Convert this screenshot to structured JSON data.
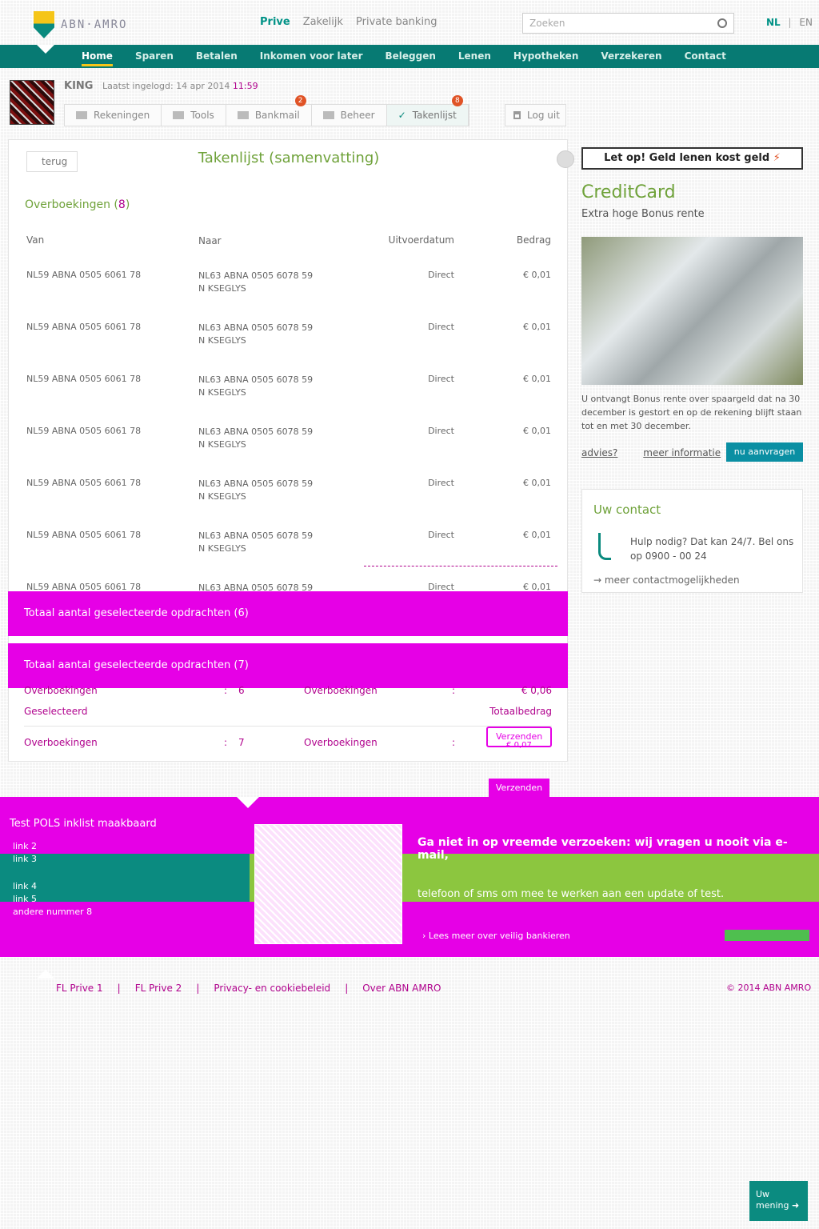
{
  "header": {
    "logo_text": "ABN·AMRO",
    "nav": [
      "Prive",
      "Zakelijk",
      "Private banking"
    ],
    "search_placeholder": "Zoeken",
    "lang_nl": "NL",
    "lang_sep": "|",
    "lang_en": "EN"
  },
  "mainnav": [
    "Home",
    "Sparen",
    "Betalen",
    "Inkomen voor later",
    "Beleggen",
    "Lenen",
    "Hypotheken",
    "Verzekeren",
    "Contact"
  ],
  "user": {
    "name": "KING",
    "last_login_label": "Laatst ingelogd: 14 apr 2014",
    "last_login_time": "11:59"
  },
  "tools": [
    {
      "label": "Rekeningen",
      "badge": ""
    },
    {
      "label": "Tools",
      "badge": ""
    },
    {
      "label": "Bankmail",
      "badge": "2"
    },
    {
      "label": "Beheer",
      "badge": ""
    },
    {
      "label": "Takenlijst",
      "badge": "8"
    }
  ],
  "logout": "Log uit",
  "panel": {
    "back": "terug",
    "title": "Takenlijst (samenvatting)",
    "section": "Overboekingen (",
    "section_count": "8",
    "section_close": ")",
    "columns": [
      "Van",
      "Naar",
      "Uitvoerdatum",
      "Bedrag"
    ],
    "rows": [
      {
        "from": "NL59 ABNA 0505 6061 78",
        "to": "NL63 ABNA 0505 6078 59",
        "to_name": "N KSEGLYS",
        "date": "Direct",
        "amount": "€ 0,01"
      },
      {
        "from": "NL59 ABNA 0505 6061 78",
        "to": "NL63 ABNA 0505 6078 59",
        "to_name": "N KSEGLYS",
        "date": "Direct",
        "amount": "€ 0,01"
      },
      {
        "from": "NL59 ABNA 0505 6061 78",
        "to": "NL63 ABNA 0505 6078 59",
        "to_name": "N KSEGLYS",
        "date": "Direct",
        "amount": "€ 0,01"
      },
      {
        "from": "NL59 ABNA 0505 6061 78",
        "to": "NL63 ABNA 0505 6078 59",
        "to_name": "N KSEGLYS",
        "date": "Direct",
        "amount": "€ 0,01"
      },
      {
        "from": "NL59 ABNA 0505 6061 78",
        "to": "NL63 ABNA 0505 6078 59",
        "to_name": "N KSEGLYS",
        "date": "Direct",
        "amount": "€ 0,01"
      },
      {
        "from": "NL59 ABNA 0505 6061 78",
        "to": "NL63 ABNA 0505 6078 59",
        "to_name": "N KSEGLYS",
        "date": "Direct",
        "amount": "€ 0,01"
      },
      {
        "from": "NL59 ABNA 0505 6061 78",
        "to": "NL63 ABNA 0505 6078 59",
        "to_name": "",
        "date": "Direct",
        "amount": "€ 0,01"
      }
    ],
    "total_bar_1": "Totaal aantal geselecteerde opdrachten (6)",
    "total_bar_2": "Totaal aantal geselecteerde opdrachten (7)",
    "summary1": {
      "label": "Overboekingen",
      "sep": ":",
      "count": "6",
      "label2": "Overboekingen",
      "sep2": ":",
      "amount": "€ 0,06"
    },
    "selected_label": "Geselecteerd",
    "total_amount_label": "Totaalbedrag",
    "summary2": {
      "label": "Overboekingen",
      "sep": ":",
      "count": "7",
      "label2": "Overboekingen",
      "sep2": ":",
      "amount": "€ 0,07"
    },
    "verzenden": "Verzenden",
    "send_all": "Verzenden"
  },
  "right": {
    "alert": "Let op! Geld lenen kost geld",
    "cc_title": "CreditCard",
    "cc_sub": "Extra hoge Bonus rente",
    "cc_text": "U ontvangt Bonus rente over spaargeld dat na 30 december is gestort en op de rekening blijft staan tot en met 30 december.",
    "links": [
      "advies?",
      "meer informatie"
    ],
    "cta": "nu aanvragen",
    "contact_title": "Uw contact",
    "contact_text": "Hulp nodig? Dat kan 24/7. Bel ons op 0900 - 00 24",
    "contact_more": "meer contactmogelijkheden"
  },
  "band": {
    "title": "Test POLS inklist maakbaard",
    "links": [
      "link 2",
      "link 3",
      "link 4",
      "link 5",
      "andere nummer 8"
    ],
    "headline": "Ga niet in op vreemde verzoeken: wij vragen u nooit via e-mail,",
    "body": "telefoon of sms om mee te werken aan een update of test.",
    "link": "Lees meer over veilig bankieren"
  },
  "footer": {
    "links": [
      "FL Prive 1",
      "FL Prive 2",
      "Privacy- en cookiebeleid",
      "Over ABN AMRO"
    ],
    "copyright": "© 2014 ABN AMRO"
  },
  "feedback": "Uw mening"
}
